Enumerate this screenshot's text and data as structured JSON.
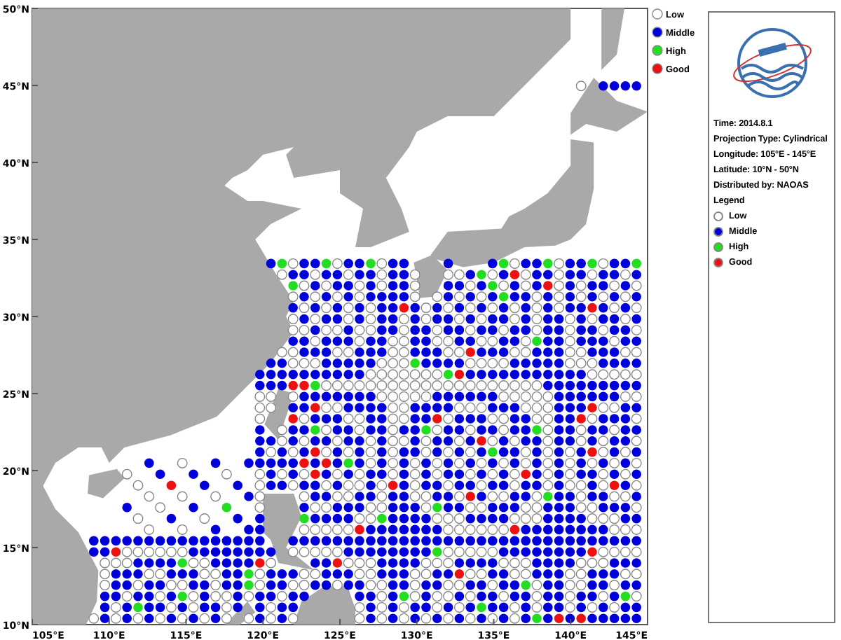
{
  "map": {
    "y_ticks": [
      "50°N",
      "45°N",
      "40°N",
      "35°N",
      "30°N",
      "25°N",
      "20°N",
      "15°N",
      "10°N"
    ],
    "x_ticks": [
      "105°E",
      "110°E",
      "115°E",
      "120°E",
      "125°E",
      "130°E",
      "135°E",
      "140°E",
      "145°E"
    ],
    "legend": [
      {
        "label": "Low",
        "color": "#ffffff"
      },
      {
        "label": "Middle",
        "color": "#0000dd"
      },
      {
        "label": "High",
        "color": "#22dd22"
      },
      {
        "label": "Good",
        "color": "#ee1111"
      }
    ]
  },
  "info_panel": {
    "lines": [
      "Time: 2014.8.1",
      "Projection Type: Cylindrical",
      "Longitude: 105°E - 145°E",
      "Latitude: 10°N - 50°N",
      "Distributed by: NAOAS"
    ],
    "legend_title": "Legend",
    "legend": [
      {
        "label": "Low",
        "color": "#ffffff"
      },
      {
        "label": "Middle",
        "color": "#0000dd"
      },
      {
        "label": "High",
        "color": "#22dd22"
      },
      {
        "label": "Good",
        "color": "#ee1111"
      }
    ]
  }
}
